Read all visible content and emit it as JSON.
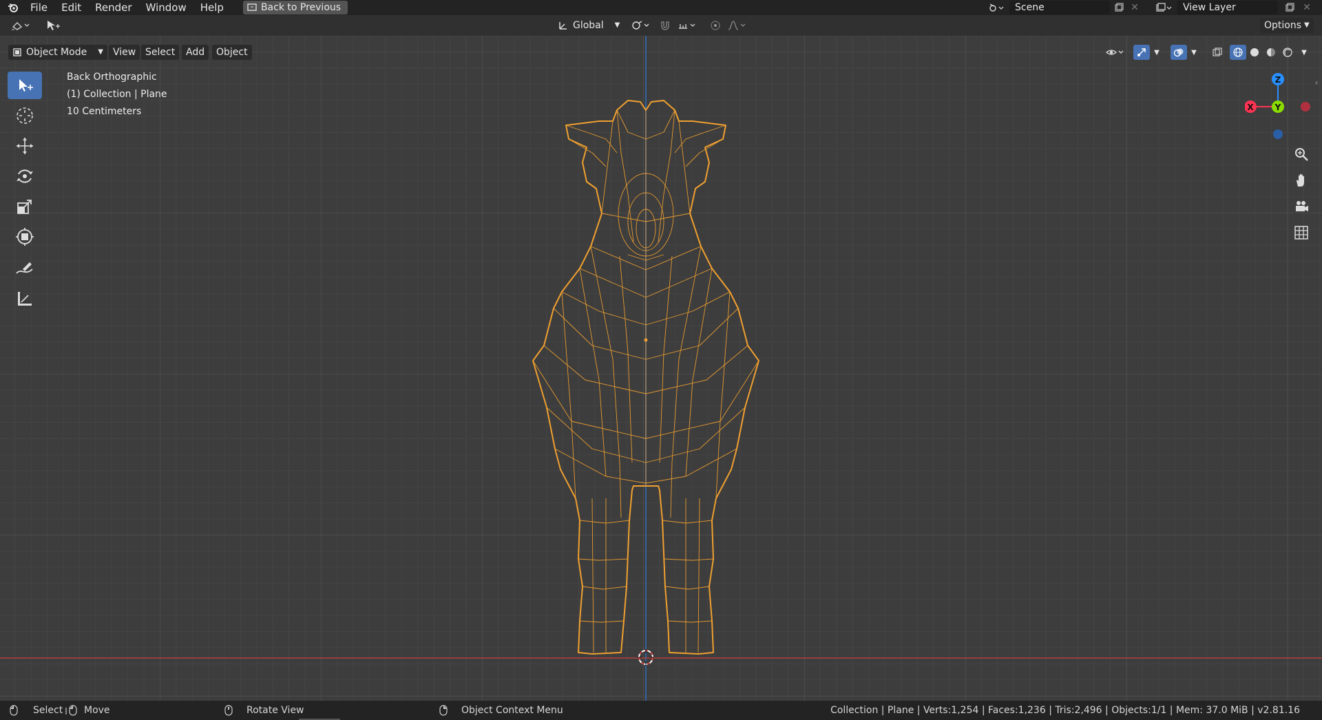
{
  "menu": {
    "items": [
      "File",
      "Edit",
      "Render",
      "Window",
      "Help"
    ],
    "back_button": "Back to Previous"
  },
  "scene": {
    "label": "Scene"
  },
  "view_layer": {
    "label": "View Layer"
  },
  "toolbar": {
    "transform_orientation": "Global",
    "options": "Options"
  },
  "header": {
    "mode": "Object Mode",
    "view": "View",
    "select": "Select",
    "add": "Add",
    "object": "Object"
  },
  "viewport": {
    "view_name": "Back Orthographic",
    "collection": "(1) Collection | Plane",
    "scale": "10 Centimeters"
  },
  "gizmo": {
    "z": "Z",
    "x": "X",
    "y": "Y"
  },
  "status": {
    "select": "Select",
    "move": "Move",
    "rotate": "Rotate View",
    "context": "Object Context Menu",
    "stats": "Collection | Plane | Verts:1,254 | Faces:1,236 | Tris:2,496 | Objects:1/1 | Mem: 37.0 MiB | v2.81.16"
  },
  "colors": {
    "accent": "#4772b3",
    "wire": "#f0a030",
    "x_axis": "#ff3352",
    "y_axis": "#8bdc00",
    "z_axis": "#2890ff"
  }
}
